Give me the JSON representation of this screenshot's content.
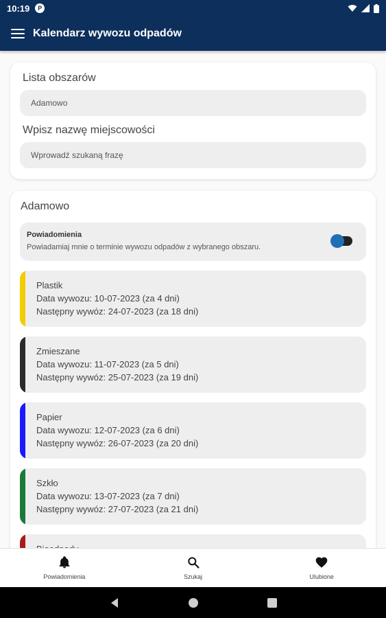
{
  "status_bar": {
    "time": "10:19",
    "app_icon_letter": "P"
  },
  "app_bar": {
    "title": "Kalendarz wywozu odpadów"
  },
  "search_card": {
    "areas_label": "Lista obszarów",
    "areas_value": "Adamowo",
    "town_label": "Wpisz nazwę miejscowości",
    "town_placeholder": "Wprowadź szukaną frazę"
  },
  "area_card": {
    "title": "Adamowo",
    "notifications": {
      "title": "Powiadomienia",
      "description": "Powiadamiaj mnie o terminie wywozu odpadów z wybranego obszaru.",
      "enabled": true
    },
    "items": [
      {
        "name": "Plastik",
        "date": "Data wywozu: 10-07-2023 (za 4 dni)",
        "next": "Następny wywóz: 24-07-2023 (za 18 dni)",
        "color": "#f2cd00"
      },
      {
        "name": "Zmieszane",
        "date": "Data wywozu: 11-07-2023 (za 5 dni)",
        "next": "Następny wywóz: 25-07-2023 (za 19 dni)",
        "color": "#2b2b2b"
      },
      {
        "name": "Papier",
        "date": "Data wywozu: 12-07-2023 (za 6 dni)",
        "next": "Następny wywóz: 26-07-2023 (za 20 dni)",
        "color": "#1a1aff"
      },
      {
        "name": "Szkło",
        "date": "Data wywozu: 13-07-2023 (za 7 dni)",
        "next": "Następny wywóz: 27-07-2023 (za 21 dni)",
        "color": "#1b7a3a"
      },
      {
        "name": "Bioodpady",
        "date": "",
        "next": "",
        "color": "#a61b1b"
      }
    ]
  },
  "bottom_nav": {
    "notifications": "Powiadomienia",
    "search": "Szukaj",
    "favorites": "Ulubione"
  },
  "icons": {
    "menu": "menu-icon",
    "bell": "bell-icon",
    "search": "search-icon",
    "heart": "heart-icon",
    "back": "back-icon",
    "home": "home-icon",
    "recents": "recents-icon"
  },
  "colors": {
    "primary": "#0d2f5c",
    "toggle_accent": "#1f6fb5"
  }
}
